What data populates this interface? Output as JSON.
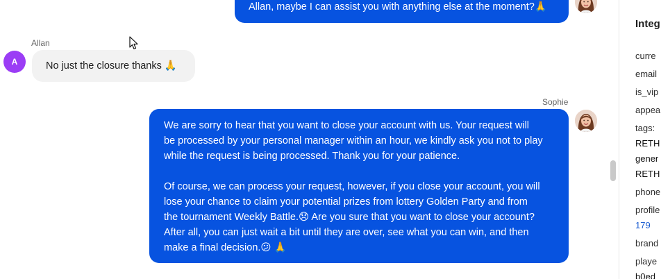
{
  "messages": [
    {
      "direction": "outgoing",
      "text": "Allan, maybe I can assist you with anything else at the moment?🙏"
    },
    {
      "direction": "incoming",
      "sender": "Allan",
      "avatar_initial": "A",
      "text": "No just the closure thanks 🙏"
    },
    {
      "direction": "outgoing",
      "sender": "Sophie",
      "paragraph1": [
        "We are sorry to hear that you want to close your account with us. Your request will",
        "be processed by your personal manager within an hour, we kindly ask you not to play",
        "while the request is being processed. Thank you for your patience."
      ],
      "paragraph2": [
        "Of course, we can process your request, however, if you close your account, you will",
        "lose your chance to claim your potential prizes from lottery Golden Party and from",
        "the tournament Weekly Battle.😞 Are you sure that you want to close your account?",
        "After all, you can just wait a bit until they are over, see what you can win, and then",
        "make a final decision.😕 🙏"
      ]
    }
  ],
  "side_panel": {
    "title": "Integ",
    "lines": [
      "curre",
      "email",
      "is_vip",
      "appea",
      "tags:",
      "RETH",
      "gener",
      "RETH",
      "phone",
      "profile",
      "179",
      "brand",
      "playe",
      "b0ed"
    ]
  },
  "colors": {
    "outgoing_bubble": "#0753e0",
    "incoming_bubble": "#f2f2f2",
    "avatar_allan": "#9b3df5",
    "link": "#1d5fd1"
  }
}
